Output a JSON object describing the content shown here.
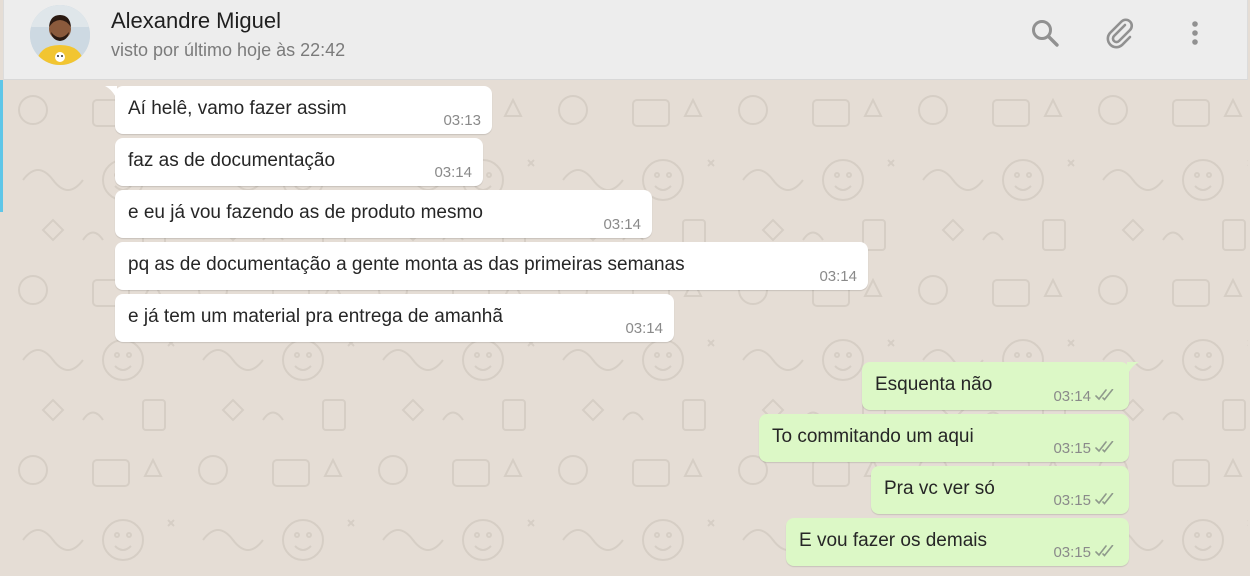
{
  "header": {
    "contact_name": "Alexandre Miguel",
    "last_seen": "visto por último hoje às 22:42",
    "icons": [
      "search-icon",
      "attach-icon",
      "menu-icon"
    ]
  },
  "messages": [
    {
      "direction": "in",
      "text": "Aí helê, vamo fazer assim",
      "time": "03:13",
      "tail": true
    },
    {
      "direction": "in",
      "text": "faz as de documentação",
      "time": "03:14"
    },
    {
      "direction": "in",
      "text": "e eu já vou fazendo as de produto mesmo",
      "time": "03:14"
    },
    {
      "direction": "in",
      "text": "pq as de documentação a gente monta as das primeiras semanas",
      "time": "03:14"
    },
    {
      "direction": "in",
      "text": "e já tem um material pra entrega de amanhã",
      "time": "03:14"
    },
    {
      "direction": "out",
      "text": "Esquenta não",
      "time": "03:14",
      "status": "read",
      "tail": true
    },
    {
      "direction": "out",
      "text": "To commitando um aqui",
      "time": "03:15",
      "status": "read"
    },
    {
      "direction": "out",
      "text": "Pra vc ver só",
      "time": "03:15",
      "status": "read"
    },
    {
      "direction": "out",
      "text": "E vou fazer os demais",
      "time": "03:15",
      "status": "read"
    }
  ],
  "colors": {
    "header_bg": "#ededed",
    "chat_bg": "#e5ddd5",
    "incoming_bubble": "#ffffff",
    "outgoing_bubble": "#dcf8c6",
    "icon": "#919191"
  }
}
